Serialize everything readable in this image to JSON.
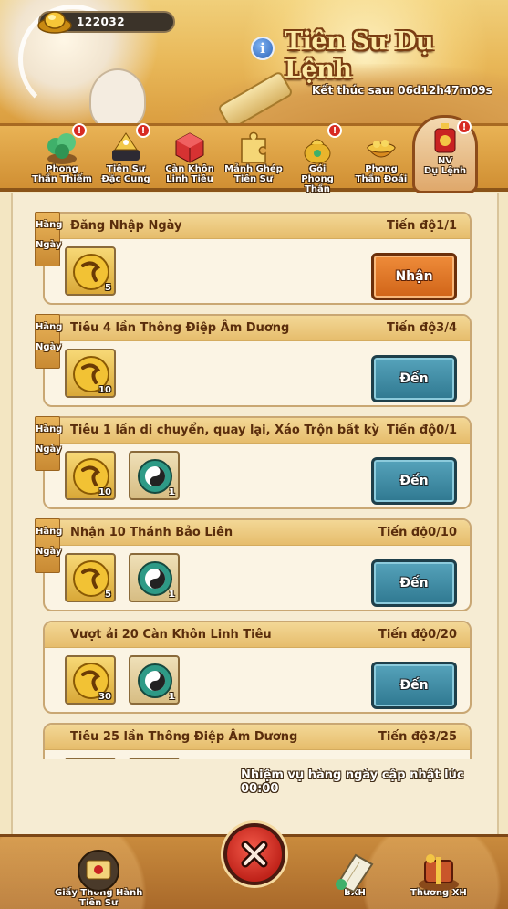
{
  "header": {
    "currency_amount": "122032",
    "info_icon": "info-icon",
    "title": "Tiên Sư Dụ Lệnh",
    "end_time": "Kết thúc sau: 06d12h47m09s"
  },
  "tabs": [
    {
      "label_line1": "Phong",
      "label_line2": "Thần Thiếm",
      "alert": "!",
      "icon": "crystal-tree-icon"
    },
    {
      "label_line1": "Tiên Sư",
      "label_line2": "Đặc Cung",
      "alert": "!",
      "icon": "fairy-hat-icon"
    },
    {
      "label_line1": "Càn Khôn",
      "label_line2": "Linh Tiêu",
      "alert": "",
      "icon": "red-cube-icon"
    },
    {
      "label_line1": "Mảnh Ghép",
      "label_line2": "Tiên Sư",
      "alert": "",
      "icon": "puzzle-piece-icon"
    },
    {
      "label_line1": "Gói",
      "label_line2": "Phong Thần",
      "alert": "!",
      "icon": "gold-bag-icon"
    },
    {
      "label_line1": "Phong",
      "label_line2": "Thần Đoái",
      "alert": "",
      "icon": "gold-bowl-icon"
    },
    {
      "label_line1": "NV",
      "label_line2": "Dụ Lệnh",
      "alert": "!",
      "icon": "decree-lantern-icon"
    }
  ],
  "daily_tag": {
    "line1": "Hàng",
    "line2": "Ngày"
  },
  "tasks": [
    {
      "title": "Đăng Nhập Ngày",
      "progress": "Tiến độ1/1",
      "daily": true,
      "rewards": [
        {
          "icon": "gold-token-icon",
          "count": "5"
        }
      ],
      "action": "Nhận",
      "action_type": "claim"
    },
    {
      "title": "Tiêu 4 lần Thông Điệp Âm Dương",
      "progress": "Tiến độ3/4",
      "daily": true,
      "rewards": [
        {
          "icon": "gold-token-icon",
          "count": "10"
        }
      ],
      "action": "Đến",
      "action_type": "go"
    },
    {
      "title": "Tiêu 1 lần di chuyển, quay lại, Xáo Trộn bất kỳ",
      "progress": "Tiến độ0/1",
      "daily": true,
      "rewards": [
        {
          "icon": "gold-token-icon",
          "count": "10"
        },
        {
          "icon": "yin-yang-icon",
          "count": "1"
        }
      ],
      "action": "Đến",
      "action_type": "go"
    },
    {
      "title": "Nhận 10 Thánh Bảo Liên",
      "progress": "Tiến độ0/10",
      "daily": true,
      "rewards": [
        {
          "icon": "gold-token-icon",
          "count": "5"
        },
        {
          "icon": "yin-yang-icon",
          "count": "1"
        }
      ],
      "action": "Đến",
      "action_type": "go"
    },
    {
      "title": "Vượt ải 20 Càn Khôn Linh Tiêu",
      "progress": "Tiến độ0/20",
      "daily": false,
      "rewards": [
        {
          "icon": "gold-token-icon",
          "count": "30"
        },
        {
          "icon": "yin-yang-icon",
          "count": "1"
        }
      ],
      "action": "Đến",
      "action_type": "go"
    },
    {
      "title": "Tiêu 25 lần Thông Điệp Âm Dương",
      "progress": "Tiến độ3/25",
      "daily": false,
      "rewards": [
        {
          "icon": "gold-token-icon",
          "count": ""
        },
        {
          "icon": "yin-yang-icon",
          "count": ""
        }
      ],
      "action": "",
      "action_type": "go"
    }
  ],
  "refresh_note": "Nhiệm vụ hàng ngày cập nhật lúc 00:00",
  "bottom": {
    "pass_label_line1": "Giấy Thông Hành",
    "pass_label_line2": "Tiên Sư",
    "close_icon": "close-icon",
    "rank_label": "BXH",
    "rank_reward_label": "Thưởng XH"
  }
}
